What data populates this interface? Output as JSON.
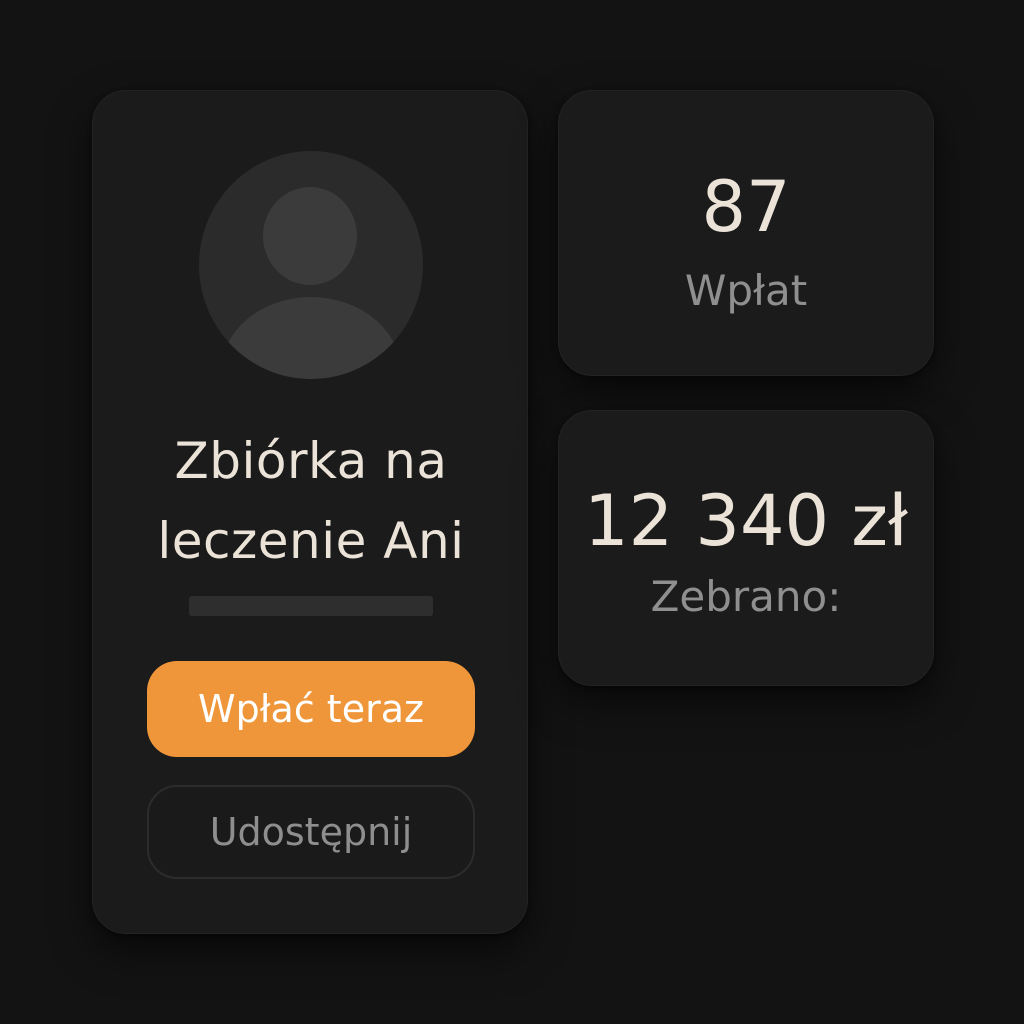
{
  "campaign": {
    "title_line1": "Zbiórka na",
    "title_line2": "leczenie Ani",
    "primary_button": "Wpłać teraz",
    "secondary_button": "Udostępnij",
    "avatar_icon": "user-avatar-placeholder-icon"
  },
  "stats": {
    "donations_value": "87",
    "donations_label": "Wpłat",
    "raised_value": "12 340 zł",
    "raised_label": "Zebrano:"
  },
  "colors": {
    "background": "#131313",
    "card": "#1b1b1b",
    "accent": "#f0963a",
    "text_primary": "#ece3d8",
    "text_secondary": "#8f8f8f"
  }
}
